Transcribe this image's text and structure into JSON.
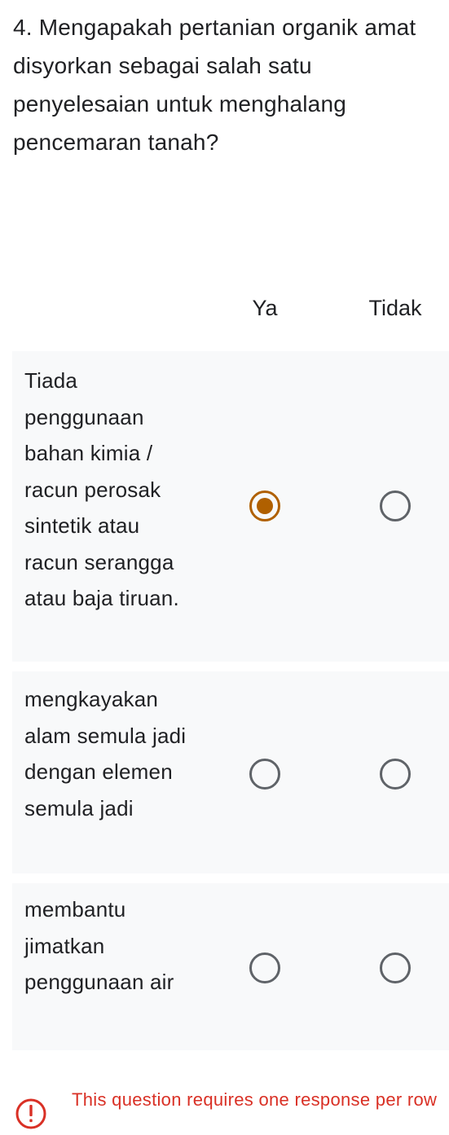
{
  "question": {
    "title": "4. Mengapakah pertanian organik amat disyorkan sebagai salah satu penyelesaian untuk menghalang pencemaran tanah?"
  },
  "columns": [
    "Ya",
    "Tidak"
  ],
  "rows": [
    {
      "label": "Tiada penggunaan bahan kimia / racun perosak sintetik atau racun serangga atau baja tiruan.",
      "selected": "Ya"
    },
    {
      "label": "mengkayakan alam semula jadi dengan elemen semula jadi",
      "selected": null
    },
    {
      "label": "membantu jimatkan penggunaan air",
      "selected": null
    }
  ],
  "validation": {
    "message": "This question requires one response per row",
    "icon": "error-icon",
    "color": "#d93025"
  },
  "colors": {
    "accent": "#b06000",
    "row_background": "#f8f9fa",
    "radio_border": "#5f6368"
  }
}
